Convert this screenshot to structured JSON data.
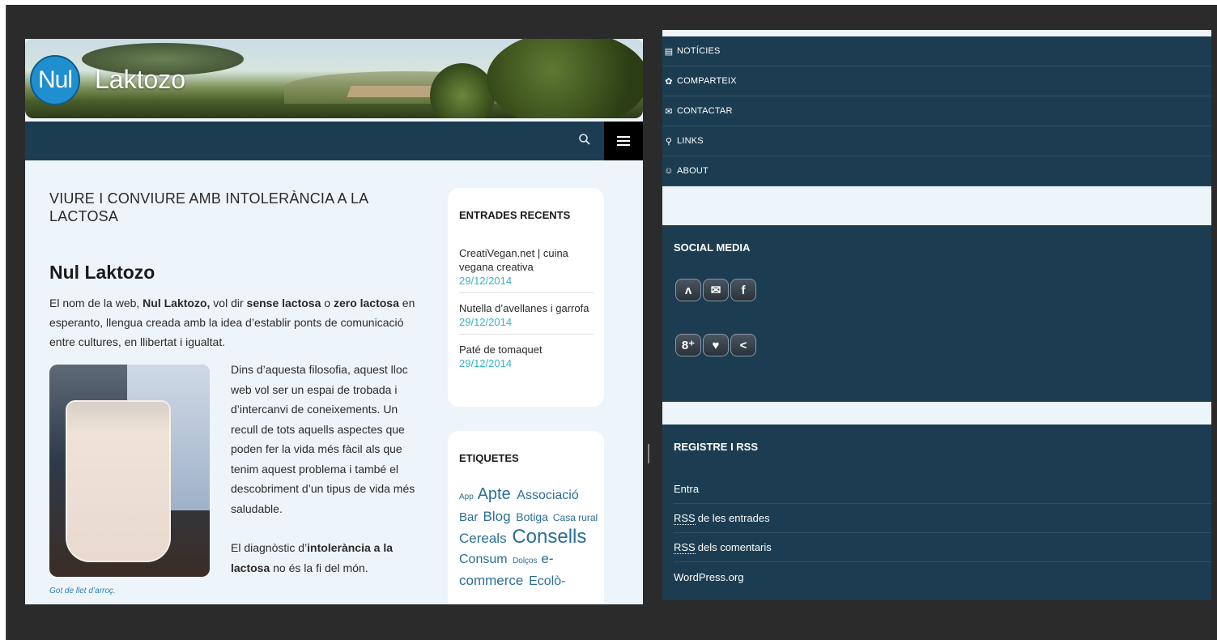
{
  "site": {
    "logo_mark": "Nul",
    "logo_text": "Laktozo",
    "page_title": "VIURE I CONVIURE AMB INTOLERÀNCIA A LA LACTOSA",
    "heading": "Nul Laktozo",
    "intro": {
      "p1": "El nom de la web, ",
      "b1": "Nul Laktozo,",
      "p2": " vol dir ",
      "b2": "sense lactosa",
      "p3": " o ",
      "b3": "zero lactosa",
      "p4": " en esperanto, llengua creada amb la idea d’establir ponts de comunicació entre cultures, en llibertat i igualtat."
    },
    "body_text_1": "Dins d’aquesta filosofia, aquest lloc web vol ser un espai de trobada i d’intercanvi de coneixements. Un recull de tots aquells aspectes que poden fer la vida més fàcil als que tenim aquest problema i també el descobriment d’un tipus de vida més saludable.",
    "body_text_2a": "El diagnòstic d’",
    "body_text_2b": "intolerància a la lactosa",
    "body_text_2c": " no és la fi del món.",
    "photo_caption": "Got de llet d’arroç.",
    "recent": {
      "title": "ENTRADES RECENTS",
      "items": [
        {
          "link": "CreatiVegan.net | cuina vegana creativa",
          "date": "29/12/2014"
        },
        {
          "link": "Nutella d’avellanes i garrofa",
          "date": "29/12/2014"
        },
        {
          "link": "Paté de tomaquet",
          "date": "29/12/2014"
        }
      ]
    },
    "tags": {
      "title": "ETIQUETES",
      "items": [
        {
          "label": "App",
          "size": 10
        },
        {
          "label": "Apte",
          "size": 20
        },
        {
          "label": "Associació",
          "size": 16
        },
        {
          "label": "Bar",
          "size": 15
        },
        {
          "label": "Blog",
          "size": 17
        },
        {
          "label": "Botiga",
          "size": 14
        },
        {
          "label": "Casa rural",
          "size": 12
        },
        {
          "label": "Cereals",
          "size": 17
        },
        {
          "label": "Consells",
          "size": 24
        },
        {
          "label": "Consum",
          "size": 16
        },
        {
          "label": "Dolços",
          "size": 10
        },
        {
          "label": "e-commerce",
          "size": 17
        },
        {
          "label": "Ecolò-",
          "size": 16
        }
      ]
    }
  },
  "right": {
    "menu": [
      {
        "icon": "newspaper-icon",
        "glyph": "▤",
        "label": "NOTÍCIES"
      },
      {
        "icon": "share-icon",
        "glyph": "✿",
        "label": "COMPARTEIX"
      },
      {
        "icon": "envelope-icon",
        "glyph": "✉",
        "label": "CONTACTAR"
      },
      {
        "icon": "link-icon",
        "glyph": "⚲",
        "label": "LINKS"
      },
      {
        "icon": "smiley-icon",
        "glyph": "☺",
        "label": "ABOUT"
      }
    ],
    "social": {
      "title": "SOCIAL MEDIA",
      "row1": [
        {
          "icon": "rss-icon",
          "glyph": "ʌ"
        },
        {
          "icon": "mail-icon",
          "glyph": "✉"
        },
        {
          "icon": "facebook-icon",
          "glyph": "f"
        }
      ],
      "row2": [
        {
          "icon": "google-plus-icon",
          "glyph": "8⁺"
        },
        {
          "icon": "twitter-icon",
          "glyph": "♥"
        },
        {
          "icon": "share-icon",
          "glyph": "<"
        }
      ]
    },
    "rss": {
      "title": "REGISTRE I RSS",
      "items": [
        {
          "abbr": "",
          "label": "Entra"
        },
        {
          "abbr": "RSS",
          "label": "de les entrades"
        },
        {
          "abbr": "RSS",
          "label": "dels comentaris"
        },
        {
          "abbr": "",
          "label": "WordPress.org"
        }
      ]
    }
  },
  "colors": {
    "navy": "#1c3d51",
    "date_teal": "#3ab3c3",
    "tag_blue": "#2a6f96"
  }
}
